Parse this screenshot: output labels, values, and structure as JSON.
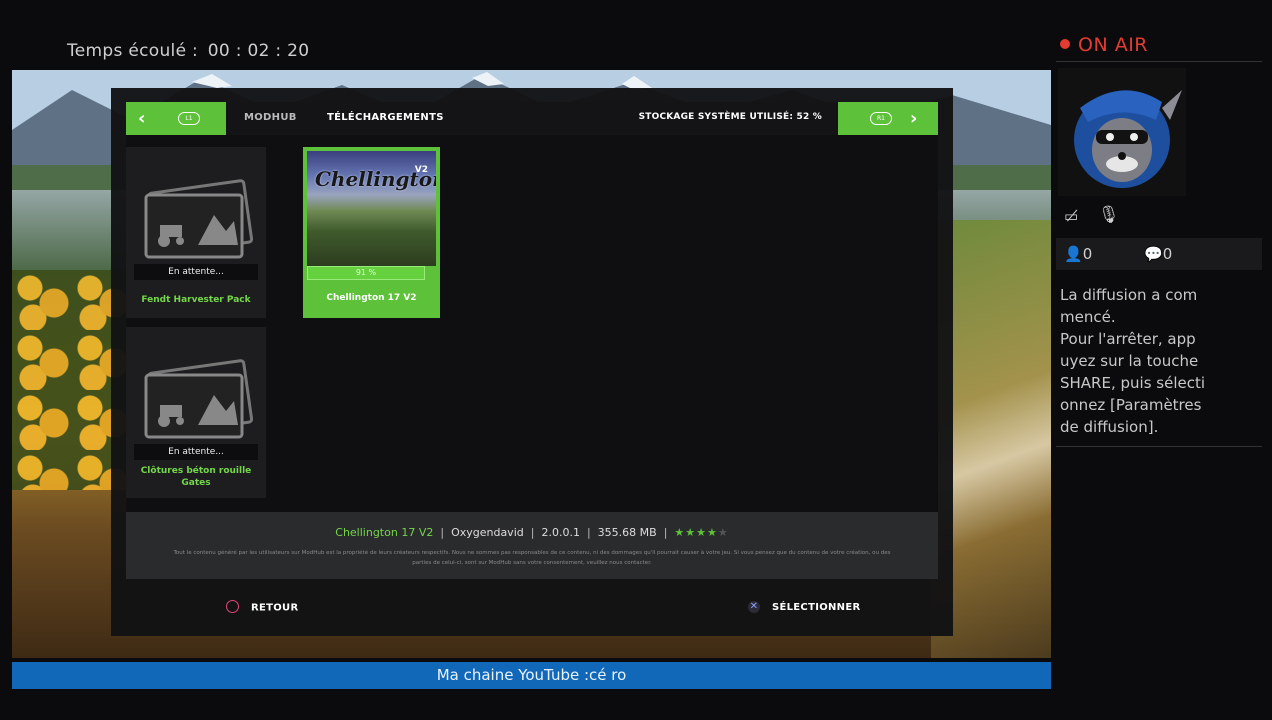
{
  "elapsed": {
    "label": "Temps écoulé :",
    "time": "00 : 02 : 20"
  },
  "topbar": {
    "prev_button": "L1",
    "next_button": "R1",
    "tab_modhub": "MODHUB",
    "tab_downloads": "TÉLÉCHARGEMENTS",
    "storage": "STOCKAGE SYSTÈME UTILISÉ: 52 %"
  },
  "downloads": [
    {
      "name": "Fendt Harvester Pack",
      "status": "En attente..."
    },
    {
      "name": "Clôtures béton rouille Gates",
      "status": "En attente..."
    }
  ],
  "selected_mod": {
    "image_title": "Chellington",
    "image_version": "V2",
    "progress_text": "91 %",
    "progress": 0.91,
    "name": "Chellington 17 V2"
  },
  "info": {
    "mod_name": "Chellington 17 V2",
    "author": "Oxygendavid",
    "version": "2.0.0.1",
    "size": "355.68 MB",
    "rating": 4,
    "rating_max": 5,
    "legal": "Tout le contenu généré par les utilisateurs sur ModHub est la propriété de leurs créateurs respectifs. Nous ne sommes pas responsables de ce contenu, ni des dommages qu'il pourrait causer à votre jeu. Si vous pensez que du contenu de votre création, ou des parties de celui-ci, sont sur ModHub sans votre consentement, veuillez nous contacter."
  },
  "footer": {
    "back": "RETOUR",
    "select": "SÉLECTIONNER"
  },
  "youtube_bar": "Ma chaine YouTube :cé ro",
  "sidebar": {
    "on_air": "ON AIR",
    "viewers": "0",
    "comments": "0",
    "message": "La diffusion a com\nmencé.\nPour l'arrêter, app\nuyez sur la touche\nSHARE, puis sélecti\nonnez [Paramètres\nde diffusion]."
  },
  "colors": {
    "accent_green": "#5ec13a",
    "on_air_red": "#e23b31",
    "youtube_blue": "#1268b8"
  }
}
